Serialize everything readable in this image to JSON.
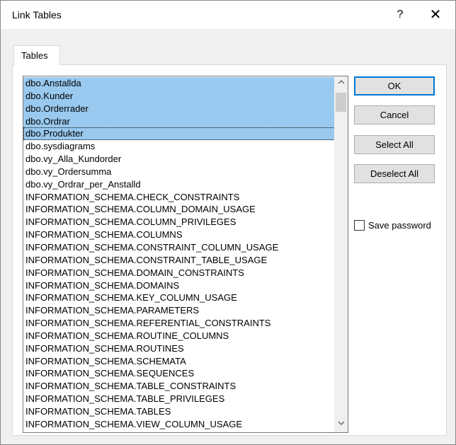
{
  "window": {
    "title": "Link Tables",
    "help_label": "?",
    "close_label": "✕"
  },
  "tabs": [
    {
      "label": "Tables"
    }
  ],
  "table_list": {
    "items": [
      "dbo.Anstallda",
      "dbo.Kunder",
      "dbo.Orderrader",
      "dbo.Ordrar",
      "dbo.Produkter",
      "dbo.sysdiagrams",
      "dbo.vy_Alla_Kundorder",
      "dbo.vy_Ordersumma",
      "dbo.vy_Ordrar_per_Anstalld",
      "INFORMATION_SCHEMA.CHECK_CONSTRAINTS",
      "INFORMATION_SCHEMA.COLUMN_DOMAIN_USAGE",
      "INFORMATION_SCHEMA.COLUMN_PRIVILEGES",
      "INFORMATION_SCHEMA.COLUMNS",
      "INFORMATION_SCHEMA.CONSTRAINT_COLUMN_USAGE",
      "INFORMATION_SCHEMA.CONSTRAINT_TABLE_USAGE",
      "INFORMATION_SCHEMA.DOMAIN_CONSTRAINTS",
      "INFORMATION_SCHEMA.DOMAINS",
      "INFORMATION_SCHEMA.KEY_COLUMN_USAGE",
      "INFORMATION_SCHEMA.PARAMETERS",
      "INFORMATION_SCHEMA.REFERENTIAL_CONSTRAINTS",
      "INFORMATION_SCHEMA.ROUTINE_COLUMNS",
      "INFORMATION_SCHEMA.ROUTINES",
      "INFORMATION_SCHEMA.SCHEMATA",
      "INFORMATION_SCHEMA.SEQUENCES",
      "INFORMATION_SCHEMA.TABLE_CONSTRAINTS",
      "INFORMATION_SCHEMA.TABLE_PRIVILEGES",
      "INFORMATION_SCHEMA.TABLES",
      "INFORMATION_SCHEMA.VIEW_COLUMN_USAGE"
    ],
    "selected": [
      "dbo.Anstallda",
      "dbo.Kunder",
      "dbo.Orderrader",
      "dbo.Ordrar",
      "dbo.Produkter"
    ],
    "focused": "dbo.Produkter",
    "scroll_up_icon": "chevron-up-icon",
    "scroll_down_icon": "chevron-down-icon",
    "selection_color": "#99c9ef"
  },
  "buttons": {
    "ok": "OK",
    "cancel": "Cancel",
    "select_all": "Select All",
    "deselect_all": "Deselect All"
  },
  "save_password": {
    "label": "Save password",
    "checked": false
  },
  "colors": {
    "default_button_border": "#0078d7",
    "dialog_background": "#f0f0f0"
  }
}
